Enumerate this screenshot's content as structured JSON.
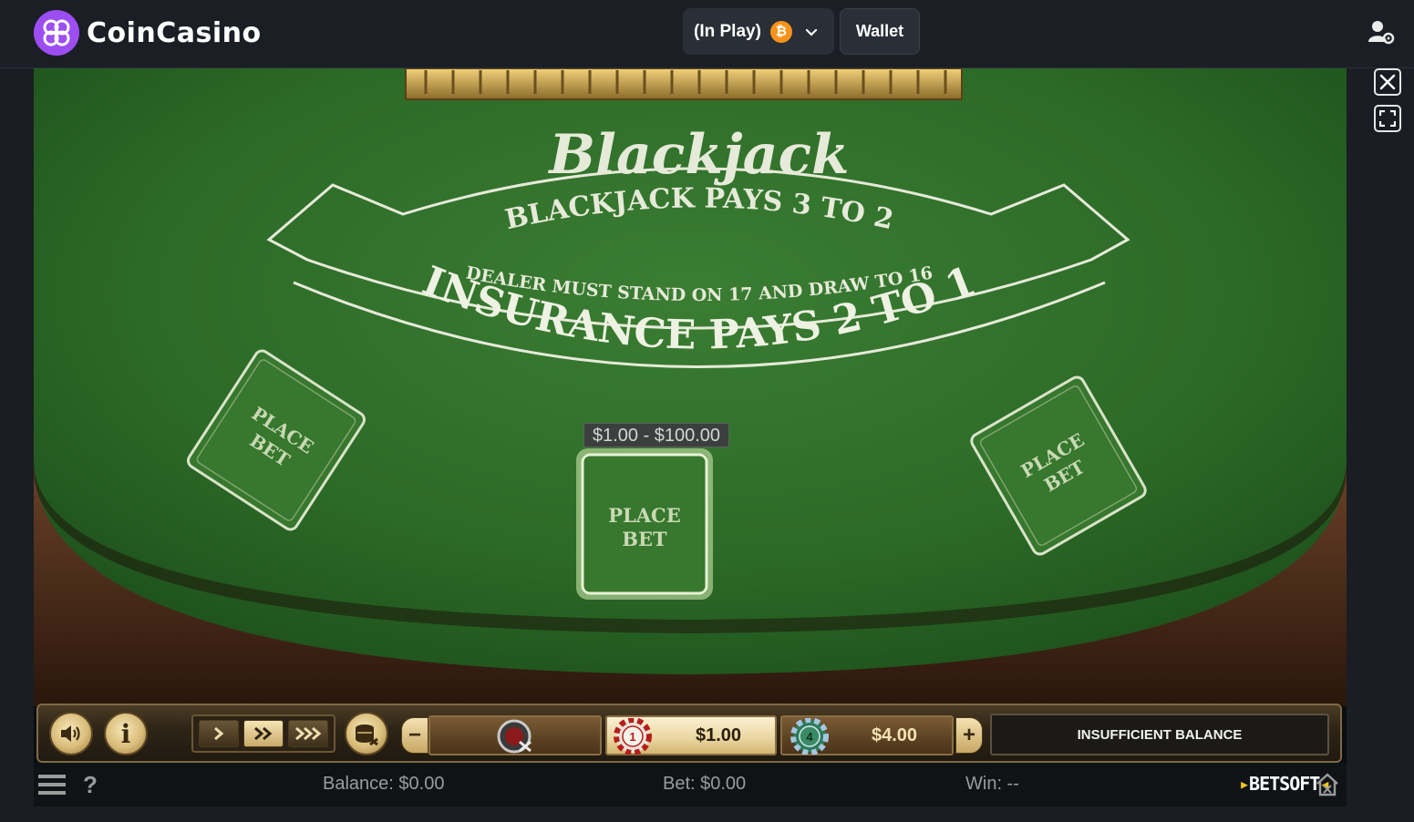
{
  "header": {
    "brand": "CoinCasino",
    "balance_selector_label": "(In Play)",
    "currency_symbol": "₿",
    "wallet_label": "Wallet"
  },
  "table": {
    "title": "Blackjack",
    "rule_line_1": "BLACKJACK PAYS 3 TO 2",
    "rule_line_2": "DEALER MUST STAND ON 17 AND DRAW TO 16",
    "insurance": "INSURANCE PAYS 2 TO 1",
    "bet_spots": [
      {
        "label_1": "PLACE",
        "label_2": "BET"
      },
      {
        "label_1": "PLACE",
        "label_2": "BET"
      },
      {
        "label_1": "PLACE",
        "label_2": "BET"
      }
    ],
    "bet_limits": "$1.00 - $100.00"
  },
  "controls": {
    "info_label": "i",
    "minus": "−",
    "plus": "+",
    "chips": [
      {
        "denomination": "1",
        "value": "$1.00"
      },
      {
        "denomination": "4",
        "value": "$4.00"
      }
    ],
    "status": "INSUFFICIENT BALANCE"
  },
  "footer": {
    "help": "?",
    "balance": "Balance: $0.00",
    "bet": "Bet: $0.00",
    "win": "Win: --",
    "provider": "BETSOFT"
  },
  "colors": {
    "brand_purple": "#9d4ef2",
    "felt_green": "#2c6a27",
    "bitcoin_orange": "#f7931a",
    "gold": "#d9bd7a"
  }
}
